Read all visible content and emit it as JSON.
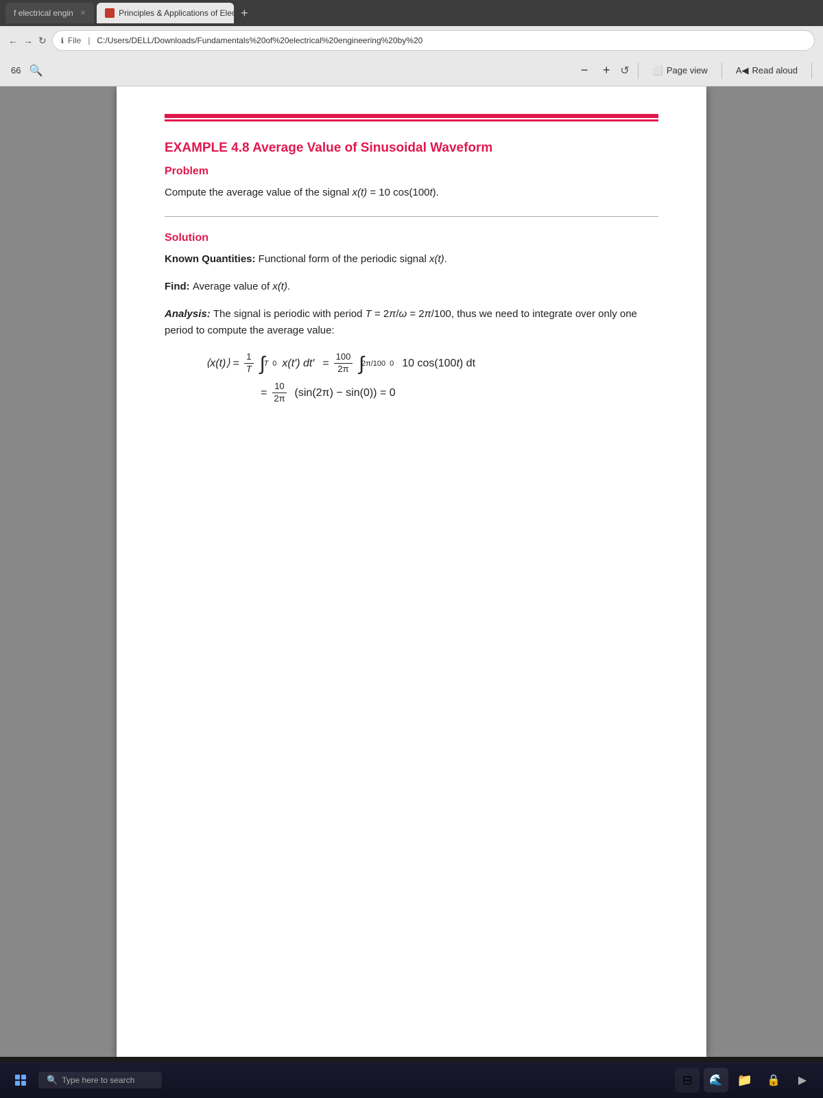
{
  "browser": {
    "tabs": [
      {
        "id": "tab1",
        "label": "f electrical engin",
        "active": false,
        "hasIcon": false
      },
      {
        "id": "tab2",
        "label": "Principles & Applications of Elec",
        "active": true,
        "hasIcon": true
      }
    ],
    "new_tab_label": "+",
    "address": "C:/Users/DELL/Downloads/Fundamentals%20of%20electrical%20engineering%20by%20",
    "address_prefix": "File"
  },
  "toolbar": {
    "page_num": "66",
    "zoom_minus": "−",
    "zoom_plus": "+",
    "rotate_label": "",
    "page_view_label": "Page view",
    "read_aloud_label": "Read aloud"
  },
  "pdf": {
    "red_bar": true,
    "example_title": "EXAMPLE  4.8  Average Value of Sinusoidal Waveform",
    "problem_label": "Problem",
    "problem_text": "Compute the average value of the signal x(t) = 10 cos(100t).",
    "solution_label": "Solution",
    "known_label": "Known Quantities:",
    "known_text": "Functional form of the periodic signal x(t).",
    "find_label": "Find:",
    "find_text": "Average value of x(t).",
    "analysis_label": "Analysis:",
    "analysis_text": "The signal is periodic with period T = 2π/ω = 2π/100, thus we need to integrate over only one period to compute the average value:",
    "math_line1_lhs": "⟨x(t)⟩ = ",
    "math_line1_frac1_num": "1",
    "math_line1_frac1_den": "T",
    "math_line1_integral1": "∫",
    "math_line1_limit1_upper": "T",
    "math_line1_limit1_lower": "0",
    "math_line1_integrand1": "x(t′) dt′",
    "math_line1_eq": " = ",
    "math_line1_frac2_num": "100",
    "math_line1_frac2_den": "2π",
    "math_line1_integral2": "∫",
    "math_line1_limit2_upper": "2π/100",
    "math_line1_limit2_lower": "0",
    "math_line1_integrand2": "10 cos(100t) dt",
    "math_line2_prefix": " = ",
    "math_line2_frac_num": "10",
    "math_line2_frac_den": "2π",
    "math_line2_rest": "(sin(2π) − sin(0)) = 0"
  },
  "taskbar": {
    "search_text": "Type here to search",
    "icons": [
      "⊞",
      "🔍",
      "🌊",
      "📁",
      "🔒",
      "▶"
    ]
  }
}
